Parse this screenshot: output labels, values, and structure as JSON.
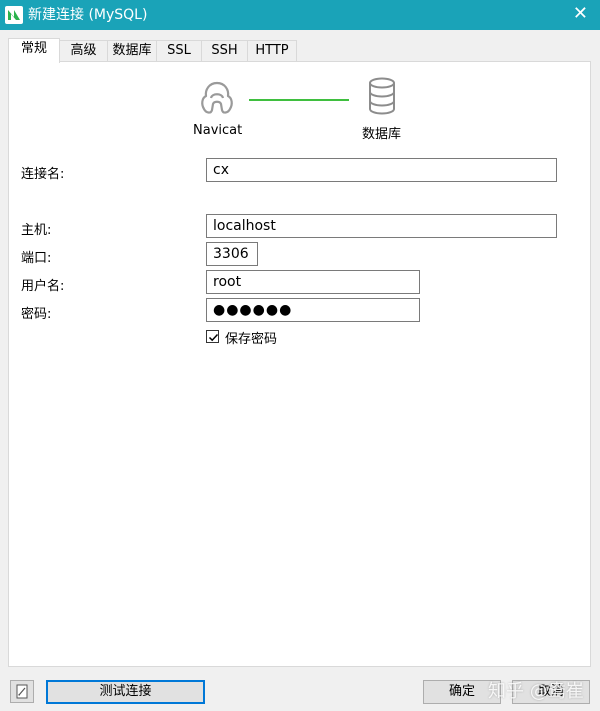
{
  "window": {
    "title": "新建连接 (MySQL)"
  },
  "tabs": [
    {
      "label": "常规",
      "active": true
    },
    {
      "label": "高级"
    },
    {
      "label": "数据库"
    },
    {
      "label": "SSL"
    },
    {
      "label": "SSH"
    },
    {
      "label": "HTTP"
    }
  ],
  "header": {
    "left_label": "Navicat",
    "right_label": "数据库",
    "link_color": "#3fbf3f"
  },
  "form": {
    "connection_name": {
      "label": "连接名:",
      "value": "cx"
    },
    "host": {
      "label": "主机:",
      "value": "localhost"
    },
    "port": {
      "label": "端口:",
      "value": "3306"
    },
    "username": {
      "label": "用户名:",
      "value": "root"
    },
    "password": {
      "label": "密码:",
      "value": "●●●●●●"
    },
    "save_password": {
      "label": "保存密码",
      "checked": true
    }
  },
  "footer": {
    "test_button": "测试连接",
    "ok_button": "确定",
    "cancel_button": "取消"
  },
  "watermark": "知乎 @鸯崔",
  "colors": {
    "titlebar": "#1aa3b8",
    "focus_border": "#0078d7"
  }
}
